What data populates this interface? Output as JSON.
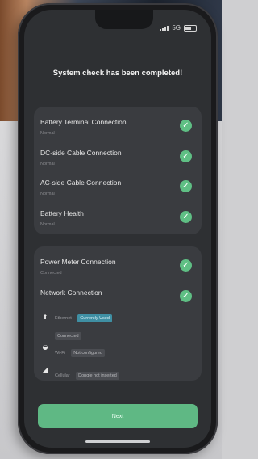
{
  "status_bar": {
    "network": "5G"
  },
  "page": {
    "title": "System check has been completed!"
  },
  "checks_group1": [
    {
      "label": "Battery Terminal Connection",
      "status": "Normal"
    },
    {
      "label": "DC-side Cable Connection",
      "status": "Normal"
    },
    {
      "label": "AC-side Cable Connection",
      "status": "Normal"
    },
    {
      "label": "Battery Health",
      "status": "Normal"
    }
  ],
  "checks_group2": {
    "power_meter": {
      "label": "Power Meter Connection",
      "status": "Connected"
    },
    "network": {
      "label": "Network Connection",
      "ethernet": {
        "label": "Ethernet",
        "chip": "Currently Used",
        "status": "Connected"
      },
      "wifi": {
        "label": "Wi-Fi",
        "chip": "Not configured"
      },
      "cellular": {
        "label": "Cellular",
        "chip": "Dongle not inserted"
      }
    }
  },
  "buttons": {
    "next": "Next"
  },
  "colors": {
    "accent": "#5fbf84",
    "active_chip": "#3f8fa3",
    "card": "#3a3c40",
    "screen": "#2e3033"
  }
}
